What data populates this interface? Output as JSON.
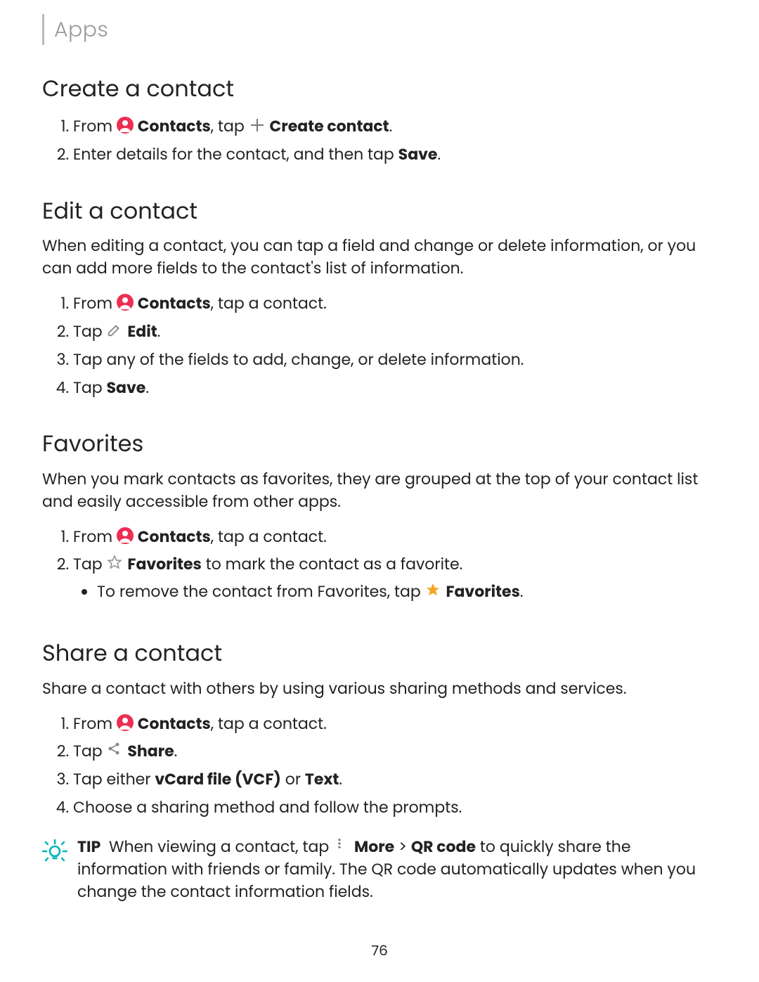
{
  "breadcrumb": "Apps",
  "page_number": "76",
  "sections": {
    "create": {
      "heading": "Create a contact",
      "step1_pre": "From ",
      "step1_contacts": "Contacts",
      "step1_mid": ", tap ",
      "step1_create": "Create contact",
      "step1_end": ".",
      "step2_a": "Enter details for the contact, and then tap ",
      "step2_b": "Save",
      "step2_c": "."
    },
    "edit": {
      "heading": "Edit a contact",
      "intro": "When editing a contact, you can tap a field and change or delete information, or you can add more fields to the contact's list of information.",
      "step1_pre": "From ",
      "step1_contacts": "Contacts",
      "step1_post": ", tap a contact.",
      "step2_pre": "Tap ",
      "step2_edit": "Edit",
      "step2_end": ".",
      "step3": "Tap any of the fields to add, change, or delete information.",
      "step4_a": "Tap ",
      "step4_b": "Save",
      "step4_c": "."
    },
    "favorites": {
      "heading": "Favorites",
      "intro": "When you mark contacts as favorites, they are grouped at the top of your contact list and easily accessible from other apps.",
      "step1_pre": "From ",
      "step1_contacts": "Contacts",
      "step1_post": ", tap a contact.",
      "step2_pre": "Tap ",
      "step2_fav": "Favorites",
      "step2_post": " to mark the contact as a favorite.",
      "sub1_pre": "To remove the contact from Favorites, tap ",
      "sub1_fav": "Favorites",
      "sub1_end": "."
    },
    "share": {
      "heading": "Share a contact",
      "intro": "Share a contact with others by using various sharing methods and services.",
      "step1_pre": "From ",
      "step1_contacts": "Contacts",
      "step1_post": ", tap a contact.",
      "step2_pre": "Tap ",
      "step2_share": "Share",
      "step2_end": ".",
      "step3_a": "Tap either ",
      "step3_b": "vCard file (VCF)",
      "step3_c": " or ",
      "step3_d": "Text",
      "step3_e": ".",
      "step4": "Choose a sharing method and follow the prompts."
    },
    "tip": {
      "label": "TIP",
      "t1": "When viewing a contact, tap ",
      "more": "More",
      "gt": " > ",
      "qr": "QR code",
      "t2": " to quickly share the information with friends or family. The QR code automatically updates when you change the contact information fields."
    }
  }
}
